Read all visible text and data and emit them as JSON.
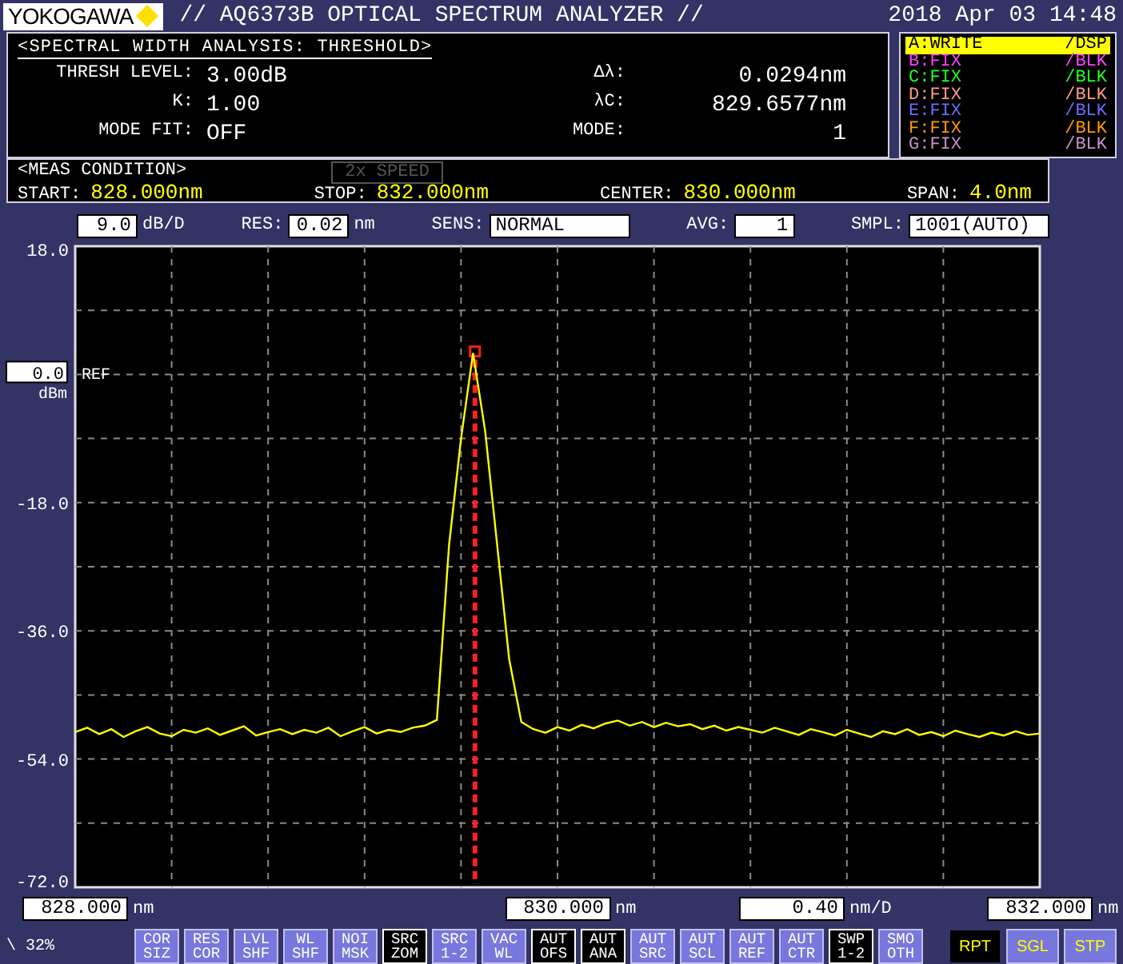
{
  "header": {
    "logo": "YOKOGAWA",
    "title": "// AQ6373B OPTICAL SPECTRUM ANALYZER //",
    "datetime": "2018 Apr 03 14:48"
  },
  "analysis": {
    "heading": "<SPECTRAL WIDTH ANALYSIS: THRESHOLD>",
    "fields": [
      {
        "label": "THRESH LEVEL:",
        "value": "3.00dB"
      },
      {
        "label": "Δλ:",
        "value": "0.0294nm"
      },
      {
        "label": "K:",
        "value": "1.00"
      },
      {
        "label": "λC:",
        "value": "829.6577nm"
      },
      {
        "label": "MODE FIT:",
        "value": "OFF"
      },
      {
        "label": "MODE:",
        "value": "1"
      }
    ]
  },
  "traces": [
    {
      "name": "A:WRITE",
      "mode": "/DSP",
      "color": "#ffff00",
      "selected": true
    },
    {
      "name": "B:FIX",
      "mode": "/BLK",
      "color": "#ff40ff",
      "selected": false
    },
    {
      "name": "C:FIX",
      "mode": "/BLK",
      "color": "#20ff20",
      "selected": false
    },
    {
      "name": "D:FIX",
      "mode": "/BLK",
      "color": "#ff9a8a",
      "selected": false
    },
    {
      "name": "E:FIX",
      "mode": "/BLK",
      "color": "#6a6aff",
      "selected": false
    },
    {
      "name": "F:FIX",
      "mode": "/BLK",
      "color": "#ff9a00",
      "selected": false
    },
    {
      "name": "G:FIX",
      "mode": "/BLK",
      "color": "#c890c8",
      "selected": false
    }
  ],
  "meas_condition": {
    "heading": "<MEAS CONDITION>",
    "speed_badge": {
      "label": "2x SPEED",
      "disabled": true
    },
    "fields": [
      {
        "label": "START:",
        "value": "828.000nm"
      },
      {
        "label": "STOP:",
        "value": "832.000nm"
      },
      {
        "label": "CENTER:",
        "value": "830.000nm"
      },
      {
        "label": "SPAN:",
        "value": "4.0nm"
      }
    ]
  },
  "settings": [
    {
      "value": "9.0",
      "unit": "dB/D"
    },
    {
      "label": "RES:",
      "value": "0.02",
      "unit": "nm"
    },
    {
      "label": "SENS:",
      "value": "NORMAL"
    },
    {
      "label": "AVG:",
      "value": "1"
    },
    {
      "label": "SMPL:",
      "value": "1001(AUTO)"
    }
  ],
  "reference": {
    "value": "0.0",
    "label": "REF",
    "unit": "dBm"
  },
  "chart_data": {
    "type": "line",
    "xlim": [
      828,
      832
    ],
    "ylim": [
      -72,
      18
    ],
    "grid": true,
    "ref_lines": [
      {
        "axis": "x",
        "value": 829.6577,
        "color": "#ff2020"
      }
    ],
    "xticks": [
      {
        "value": 828,
        "label": "828.000"
      },
      {
        "value": 830,
        "label": "830.000"
      },
      {
        "value": 832,
        "label": "832.000"
      }
    ],
    "yticks": [
      {
        "value": 18,
        "label": "18.0"
      },
      {
        "value": -18,
        "label": "-18.0"
      },
      {
        "value": -36,
        "label": "-36.0"
      },
      {
        "value": -54,
        "label": "-54.0"
      },
      {
        "value": -72,
        "label": "-72.0"
      }
    ],
    "x": [
      828,
      828.05,
      828.1,
      828.15,
      828.2,
      828.25,
      828.3,
      828.35,
      828.4,
      828.45,
      828.5,
      828.55,
      828.6,
      828.65,
      828.7,
      828.75,
      828.8,
      828.85,
      828.9,
      828.95,
      829,
      829.05,
      829.1,
      829.15,
      829.2,
      829.25,
      829.3,
      829.35,
      829.4,
      829.45,
      829.5,
      829.55,
      829.6,
      829.65,
      829.7,
      829.75,
      829.8,
      829.85,
      829.9,
      829.95,
      830,
      830.05,
      830.1,
      830.15,
      830.2,
      830.25,
      830.3,
      830.35,
      830.4,
      830.45,
      830.5,
      830.55,
      830.6,
      830.65,
      830.7,
      830.75,
      830.8,
      830.85,
      830.9,
      830.95,
      831,
      831.05,
      831.1,
      831.15,
      831.2,
      831.25,
      831.3,
      831.35,
      831.4,
      831.45,
      831.5,
      831.55,
      831.6,
      831.65,
      831.7,
      831.75,
      831.8,
      831.85,
      831.9,
      831.95,
      832
    ],
    "series": [
      {
        "color": "#ffff00",
        "values": [
          -50.2,
          -49.6,
          -50.5,
          -49.8,
          -50.9,
          -50.1,
          -49.5,
          -50.4,
          -50.8,
          -49.9,
          -50.3,
          -49.7,
          -50.6,
          -50.0,
          -49.4,
          -50.7,
          -50.2,
          -49.8,
          -50.5,
          -49.9,
          -50.3,
          -49.6,
          -50.8,
          -50.1,
          -49.5,
          -50.4,
          -49.9,
          -50.2,
          -49.6,
          -49.3,
          -48.5,
          -24.0,
          -9.0,
          3.0,
          -8.0,
          -24.0,
          -40.0,
          -48.8,
          -49.8,
          -50.3,
          -49.5,
          -50.0,
          -49.2,
          -49.7,
          -49.0,
          -48.6,
          -49.3,
          -48.8,
          -49.5,
          -48.9,
          -49.4,
          -49.1,
          -49.8,
          -49.3,
          -50.0,
          -49.5,
          -49.9,
          -50.3,
          -49.6,
          -50.1,
          -50.6,
          -49.8,
          -50.2,
          -50.7,
          -49.9,
          -50.4,
          -50.9,
          -50.1,
          -50.5,
          -49.8,
          -50.6,
          -50.2,
          -50.8,
          -50.0,
          -50.5,
          -50.9,
          -50.3,
          -50.7,
          -50.1,
          -50.6,
          -50.4
        ]
      }
    ]
  },
  "scale": [
    {
      "unit": "nm"
    },
    {
      "unit": "nm"
    },
    {
      "value": "0.40",
      "unit": "nm/D"
    },
    {
      "unit": "nm"
    }
  ],
  "status": "\\ 32%",
  "soft_keys": [
    {
      "label": "COR SIZ",
      "on": false
    },
    {
      "label": "RES COR",
      "on": false
    },
    {
      "label": "LVL SHF",
      "on": false
    },
    {
      "label": "WL SHF",
      "on": false
    },
    {
      "label": "NOI MSK",
      "on": false
    },
    {
      "label": "SRC ZOM",
      "on": true
    },
    {
      "label": "SRC 1-2",
      "on": false
    },
    {
      "label": "VAC WL",
      "on": false
    },
    {
      "label": "AUT OFS",
      "on": true
    },
    {
      "label": "AUT ANA",
      "on": true
    },
    {
      "label": "AUT SRC",
      "on": false
    },
    {
      "label": "AUT SCL",
      "on": false
    },
    {
      "label": "AUT REF",
      "on": false
    },
    {
      "label": "AUT CTR",
      "on": false
    },
    {
      "label": "SWP 1-2",
      "on": true
    },
    {
      "label": "SMO OTH",
      "on": false
    }
  ],
  "sweep_buttons": [
    {
      "label": "RPT",
      "selected": true
    },
    {
      "label": "SGL",
      "selected": false
    },
    {
      "label": "STP",
      "selected": false
    }
  ]
}
